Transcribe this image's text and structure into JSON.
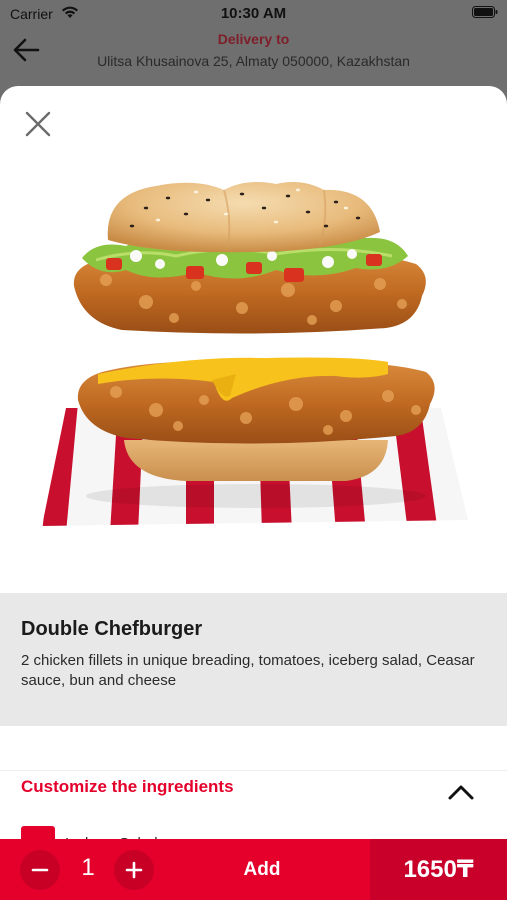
{
  "status_bar": {
    "carrier": "Carrier",
    "time": "10:30 AM"
  },
  "header": {
    "delivery_label": "Delivery to",
    "address": "Ulitsa Khusainova 25, Almaty 050000, Kazakhstan"
  },
  "product": {
    "name": "Double Chefburger",
    "description": "2 chicken fillets in unique breading, tomatoes, iceberg salad, Ceasar sauce, bun and cheese"
  },
  "customize": {
    "title": "Customize the ingredients",
    "first_item_label": "Iceberg Salad"
  },
  "cart": {
    "quantity": "1",
    "add_label": "Add",
    "price": "1650₸"
  },
  "colors": {
    "brand_red": "#e4002b",
    "dark_red": "#c8002a",
    "delivery_label": "#7e1e29",
    "info_panel_bg": "#e8e8e8"
  },
  "icons": {
    "back": "back-arrow-icon",
    "close": "close-icon",
    "collapse": "chevron-up-icon",
    "minus": "minus-icon",
    "plus": "plus-icon"
  }
}
